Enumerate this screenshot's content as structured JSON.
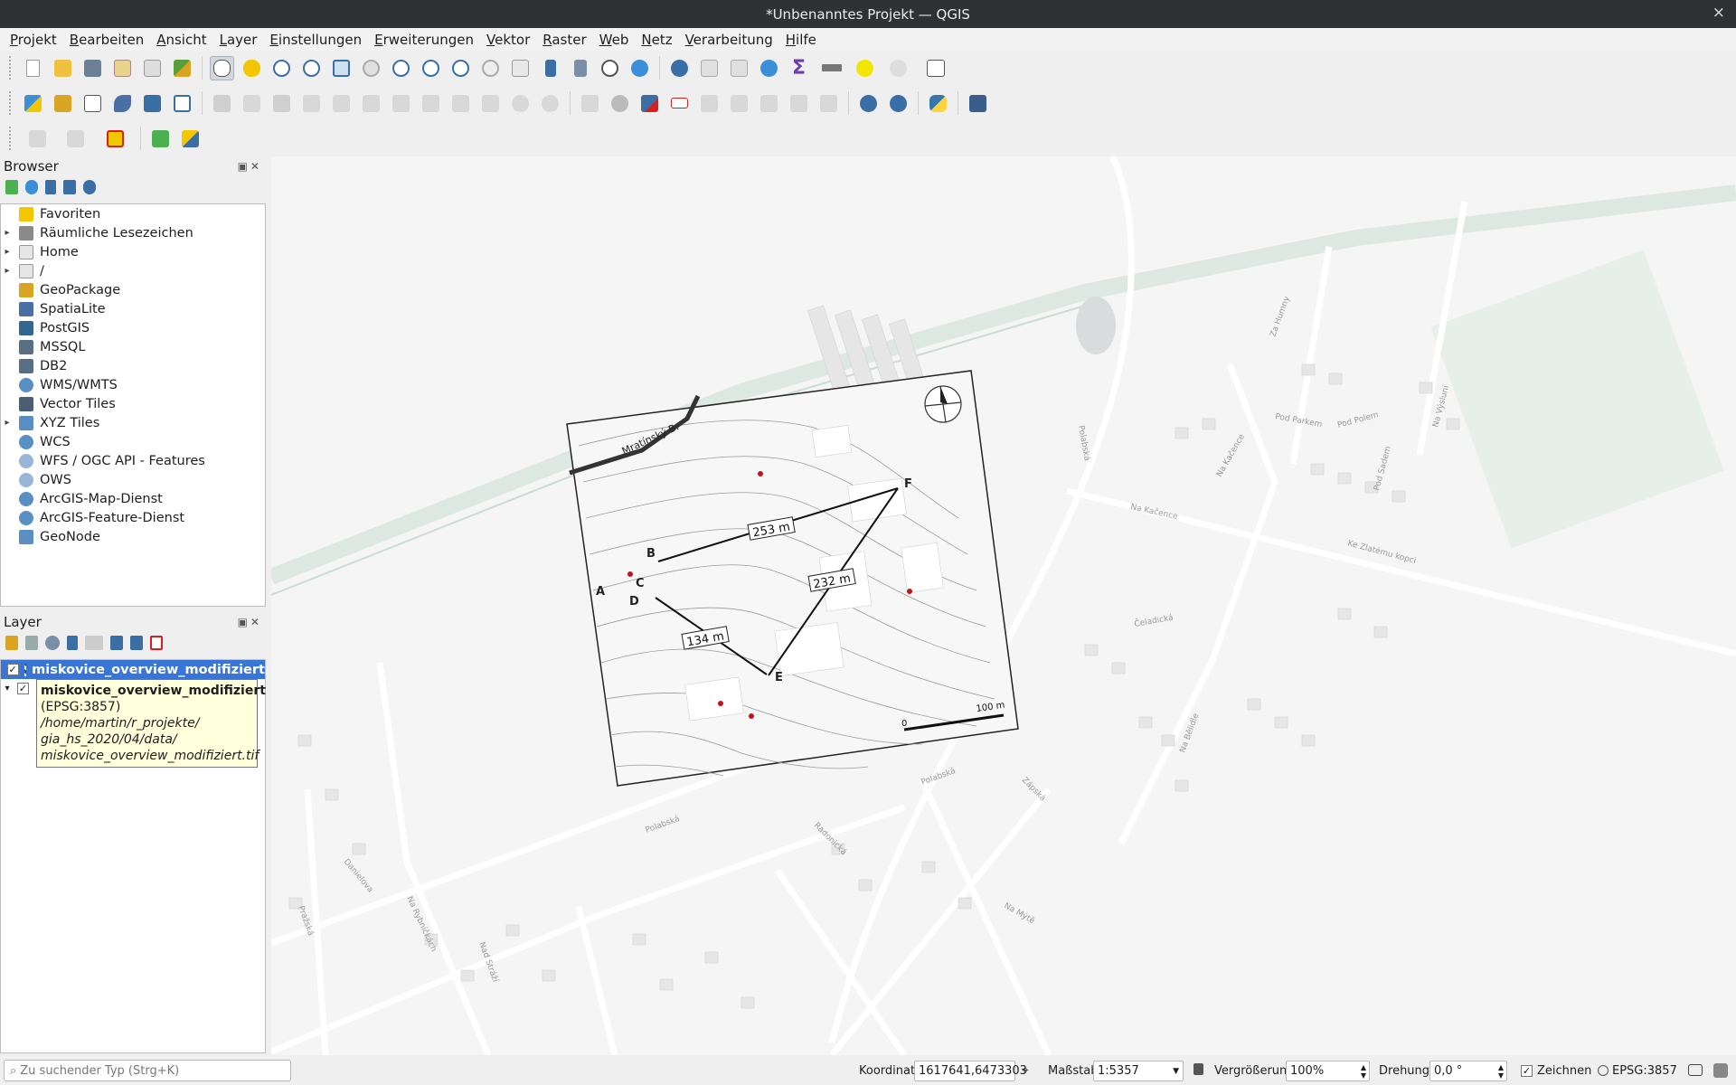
{
  "window": {
    "title": "*Unbenanntes Projekt — QGIS",
    "close_glyph": "×"
  },
  "menu": [
    "Projekt",
    "Bearbeiten",
    "Ansicht",
    "Layer",
    "Einstellungen",
    "Erweiterungen",
    "Vektor",
    "Raster",
    "Web",
    "Netz",
    "Verarbeitung",
    "Hilfe"
  ],
  "browser": {
    "title": "Browser",
    "items": [
      {
        "label": "Favoriten",
        "icon": "star-icon",
        "expandable": false,
        "color": "#f2c600"
      },
      {
        "label": "Räumliche Lesezeichen",
        "icon": "bookmark-icon",
        "expandable": true,
        "color": "#8a8a8a"
      },
      {
        "label": "Home",
        "icon": "folder-icon",
        "expandable": true,
        "color": "#e6e6e6"
      },
      {
        "label": "/",
        "icon": "folder-icon",
        "expandable": true,
        "color": "#e6e6e6"
      },
      {
        "label": "GeoPackage",
        "icon": "geopackage-icon",
        "expandable": false,
        "color": "#d9a421"
      },
      {
        "label": "SpatiaLite",
        "icon": "feather-icon",
        "expandable": false,
        "color": "#4a6fa5"
      },
      {
        "label": "PostGIS",
        "icon": "elephant-icon",
        "expandable": false,
        "color": "#336791"
      },
      {
        "label": "MSSQL",
        "icon": "mssql-icon",
        "expandable": false,
        "color": "#5a6e84"
      },
      {
        "label": "DB2",
        "icon": "db2-icon",
        "expandable": false,
        "color": "#5a6e84"
      },
      {
        "label": "WMS/WMTS",
        "icon": "globe-icon",
        "expandable": false,
        "color": "#5a8fc4"
      },
      {
        "label": "Vector Tiles",
        "icon": "grid-icon",
        "expandable": false,
        "color": "#4a5e74"
      },
      {
        "label": "XYZ Tiles",
        "icon": "xyz-grid-icon",
        "expandable": true,
        "color": "#5a8fc4"
      },
      {
        "label": "WCS",
        "icon": "globe-icon",
        "expandable": false,
        "color": "#5a8fc4"
      },
      {
        "label": "WFS / OGC API - Features",
        "icon": "globe-icon",
        "expandable": false,
        "color": "#9ab6d6"
      },
      {
        "label": "OWS",
        "icon": "globe-icon",
        "expandable": false,
        "color": "#9ab6d6"
      },
      {
        "label": "ArcGIS-Map-Dienst",
        "icon": "arcgis-icon",
        "expandable": false,
        "color": "#5a8fc4"
      },
      {
        "label": "ArcGIS-Feature-Dienst",
        "icon": "arcgis-icon",
        "expandable": false,
        "color": "#5a8fc4"
      },
      {
        "label": "GeoNode",
        "icon": "geonode-icon",
        "expandable": false,
        "color": "#5a8fc4"
      }
    ]
  },
  "layers": {
    "title": "Layer",
    "items": [
      {
        "name": "miskovice_overview_modifiziert",
        "checked": true,
        "selected": true
      },
      {
        "name": "miskovice_overview_modifiziert",
        "checked": true,
        "selected": false
      }
    ],
    "check_glyph": "✓",
    "expand_glyph": "▾",
    "tooltip": {
      "title": "miskovice_overview_modifiziert",
      "crs": "(EPSG:3857)",
      "path_lines": [
        "/home/martin/r_projekte/",
        "gia_hs_2020/04/data/",
        "miskovice_overview_modifiziert.tif"
      ]
    }
  },
  "map": {
    "street_labels": [
      "Polabská",
      "Na Kačence",
      "Ke Zlatému kopci",
      "Na Kačence",
      "Pod Parkem",
      "Pod Polem",
      "Pod Sadem",
      "Na Výsluní",
      "Za Humny",
      "Polabská",
      "Čeladická",
      "Zápská",
      "Na Bělidle",
      "Polabská",
      "Radonická",
      "Na Mýtě",
      "Danielova",
      "Na Rybníčkách",
      "Pražská",
      "Nad Stráží"
    ],
    "raster": {
      "road_label": "Mratínský B.",
      "points": [
        "A",
        "B",
        "C",
        "D",
        "E",
        "F"
      ],
      "distances": [
        "253 m",
        "232 m",
        "134 m"
      ],
      "scale_zero": "0",
      "scale_max": "100 m"
    }
  },
  "status": {
    "search_placeholder": "Zu suchender Typ (Strg+K)",
    "coordinate_label": "Koordinate",
    "coordinate_value": "1617641,6473303",
    "scale_label": "Maßstab",
    "scale_value": "1:5357",
    "magnifier_label": "Vergrößerung",
    "magnifier_value": "100%",
    "rotation_label": "Drehung",
    "rotation_value": "0,0 °",
    "render_label": "Zeichnen",
    "render_checked": true,
    "crs": "EPSG:3857"
  }
}
